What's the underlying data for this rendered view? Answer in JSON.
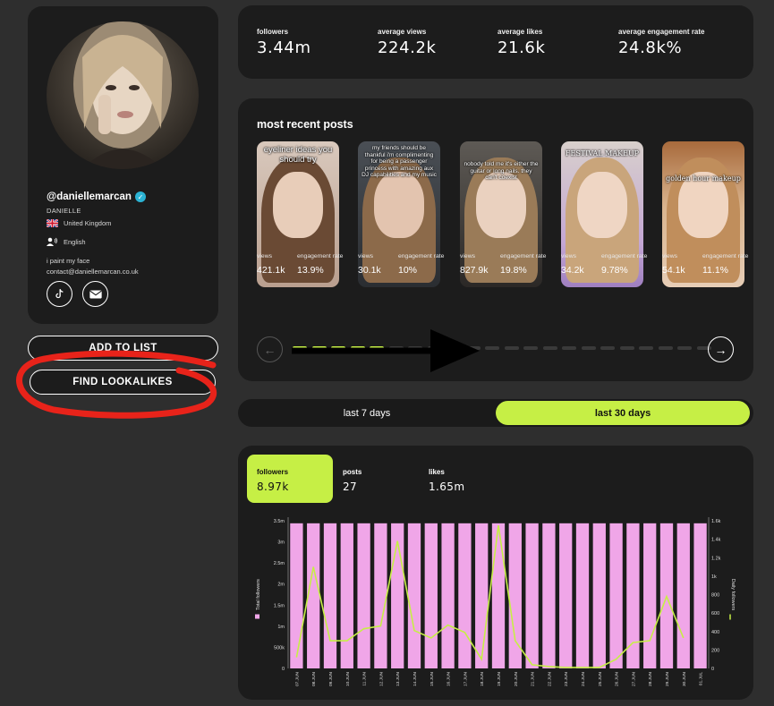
{
  "profile": {
    "handle": "@daniellemarcan",
    "display_name": "DANIELLE",
    "country": "United Kingdom",
    "language": "English",
    "bio_line1": "i paint my face",
    "bio_line2": "contact@daniellemarcan.co.uk",
    "verified_icon": "verified-check-icon",
    "social_icons": [
      "tiktok-icon",
      "email-icon"
    ]
  },
  "actions": {
    "add_to_list": "ADD TO LIST",
    "find_lookalikes": "FIND LOOKALIKES"
  },
  "stats": [
    {
      "label": "followers",
      "value": "3.44m"
    },
    {
      "label": "average views",
      "value": "224.2k"
    },
    {
      "label": "average likes",
      "value": "21.6k"
    },
    {
      "label": "average engagement rate",
      "value": "24.8k%"
    }
  ],
  "recent_posts": {
    "title": "most recent posts",
    "views_label": "views",
    "er_label": "engagement rate",
    "posts": [
      {
        "caption": "eyeliner ideas you should try",
        "views": "421.1k",
        "engagement_rate": "13.9%"
      },
      {
        "caption": "my friends should be thankful i'm complimenting for being a passenger princess with amazing aux DJ capabilities and my music",
        "views": "30.1k",
        "engagement_rate": "10%"
      },
      {
        "caption": "nobody told me it's either the guitar or long nails. they can't coexist",
        "views": "827.9k",
        "engagement_rate": "19.8%"
      },
      {
        "caption": "FESTIVAL MAKEUP",
        "views": "34.2k",
        "engagement_rate": "9.78%"
      },
      {
        "caption": "golden hour makeup",
        "views": "54.1k",
        "engagement_rate": "11.1%"
      }
    ],
    "pager": {
      "total": 22,
      "active": 5
    }
  },
  "range_toggle": {
    "option_7": "last 7 days",
    "option_30": "last 30 days",
    "selected": "last 30 days"
  },
  "growth": {
    "tabs": [
      {
        "label": "followers",
        "value": "8.97k"
      },
      {
        "label": "posts",
        "value": "27"
      },
      {
        "label": "likes",
        "value": "1.65m"
      }
    ]
  },
  "chart_data": {
    "type": "bar",
    "title": "",
    "categories": [
      "07.JUN",
      "08.JUN",
      "09.JUN",
      "10.JUN",
      "11.JUN",
      "12.JUN",
      "13.JUN",
      "14.JUN",
      "15.JUN",
      "16.JUN",
      "17.JUN",
      "18.JUN",
      "19.JUN",
      "20.JUN",
      "21.JUN",
      "22.JUN",
      "23.JUN",
      "24.JUN",
      "25.JUN",
      "26.JUN",
      "27.JUN",
      "28.JUN",
      "29.JUN",
      "30.JUN",
      "01.JUL"
    ],
    "series": [
      {
        "name": "Total followers",
        "type": "bar",
        "axis": "left",
        "color": "#f0a6e8",
        "values": [
          3440000,
          3440000,
          3440000,
          3440000,
          3440000,
          3440000,
          3440000,
          3440000,
          3440000,
          3440000,
          3440000,
          3440000,
          3440000,
          3440000,
          3440000,
          3440000,
          3440000,
          3440000,
          3440000,
          3440000,
          3440000,
          3440000,
          3440000,
          3440000,
          3440000
        ]
      },
      {
        "name": "Daily followers",
        "type": "line",
        "axis": "right",
        "color": "#c6ef45",
        "values": [
          120,
          1100,
          300,
          300,
          430,
          460,
          1380,
          410,
          330,
          470,
          390,
          100,
          1550,
          300,
          40,
          20,
          10,
          10,
          10,
          100,
          280,
          300,
          780,
          330
        ]
      }
    ],
    "ylabel": "Total followers",
    "y2label": "Daily followers",
    "ylim": [
      0,
      3500000
    ],
    "y2lim": [
      0,
      1600
    ],
    "yticks": [
      "0",
      "500k",
      "1m",
      "1.5m",
      "2m",
      "2.5m",
      "3m",
      "3.5m"
    ],
    "y2ticks": [
      "0",
      "200",
      "400",
      "600",
      "800",
      "1k",
      "1.2k",
      "1.4k",
      "1.6k"
    ],
    "legend": "vertical axis labels",
    "grid": false
  },
  "colors": {
    "accent": "#c6ef45",
    "bar": "#f0a6e8",
    "panel": "#1c1c1c",
    "background": "#2e2e2e",
    "annotation": "#e8231a"
  }
}
